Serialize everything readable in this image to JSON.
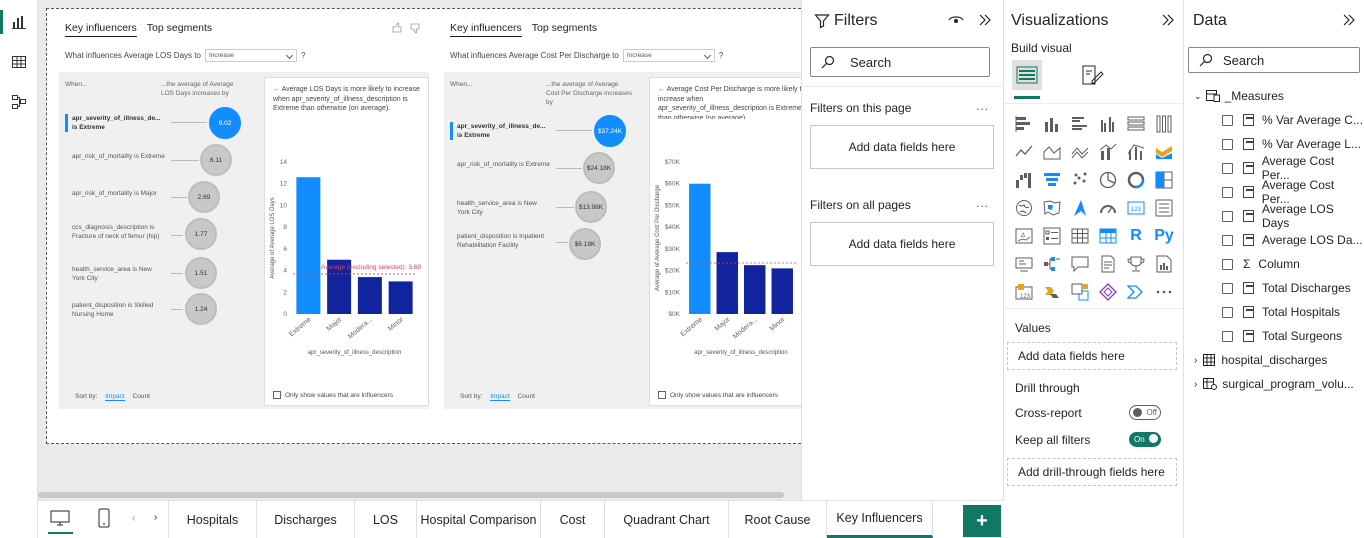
{
  "left_rail": {
    "icons": [
      "report-view-icon",
      "table-view-icon",
      "model-view-icon"
    ]
  },
  "visual1": {
    "tabs": [
      "Key influencers",
      "Top segments"
    ],
    "question": "What influences Average LOS Days to",
    "select": "Increase",
    "help": "?",
    "when": "When...",
    "then": "...the average of Average LOS Days increases by",
    "influencers": [
      {
        "label": "apr_severity_of_illness_de... is Extreme",
        "value": "9.02",
        "selected": true
      },
      {
        "label": "apr_risk_of_mortality is Extreme",
        "value": "6.11"
      },
      {
        "label": "apr_risk_of_mortality is Major",
        "value": "2.69"
      },
      {
        "label": "ccs_diagnosis_description is Fracture of neck of femur (hip)",
        "value": "1.77"
      },
      {
        "label": "health_service_area is New York City",
        "value": "1.51"
      },
      {
        "label": "patient_disposition is Skilled Nursing Home",
        "value": "1.24"
      }
    ],
    "sort_by": "Sort by:",
    "sort_impact": "Impact",
    "sort_count": "Count",
    "detail_text": "Average LOS Days is more likely to increase when apr_severity_of_illness_description is Extreme than otherwise (on average).",
    "only_show": "Only show values that are influencers",
    "chart_data": {
      "type": "bar",
      "categories": [
        "Extreme",
        "Major",
        "Modera...",
        "Minor"
      ],
      "values": [
        12.6,
        5.0,
        3.4,
        3.0
      ],
      "highlight_index": 0,
      "ylabel": "Average of Average LOS Days",
      "xlabel": "apr_severity_of_illness_description",
      "ylim": [
        0,
        14
      ],
      "yticks": [
        "0",
        "2",
        "4",
        "6",
        "8",
        "10",
        "12",
        "14"
      ],
      "ytick_values": [
        0,
        2,
        4,
        6,
        8,
        10,
        12,
        14
      ],
      "reference_value": 3.69,
      "reference_label": "Average (excluding selected): 3.69"
    }
  },
  "visual2": {
    "tabs": [
      "Key influencers",
      "Top segments"
    ],
    "question": "What influences Average Cost Per Discharge to",
    "select": "Increase",
    "help": "?",
    "when": "When...",
    "then": "...the average of Average Cost Per Discharge increases by",
    "influencers": [
      {
        "label": "apr_severity_of_illness_de... is Extreme",
        "value": "$37.24K",
        "selected": true
      },
      {
        "label": "apr_risk_of_mortality is Extreme",
        "value": "$24.18K"
      },
      {
        "label": "health_service_area is New York City",
        "value": "$13.98K"
      },
      {
        "label": "patient_disposition is Inpatient Rehabilitation Facility",
        "value": "$6.19K"
      }
    ],
    "sort_by": "Sort by:",
    "sort_impact": "Impact",
    "sort_count": "Count",
    "detail_text": "Average Cost Per Discharge is more likely to increase when apr_severity_of_illness_description is Extreme than otherwise (on average).",
    "only_show": "Only show values that are influencers",
    "chart_data": {
      "type": "bar",
      "categories": [
        "Extreme",
        "Major",
        "Modera...",
        "Minor"
      ],
      "values": [
        60000,
        28500,
        22500,
        21000
      ],
      "highlight_index": 0,
      "ylabel": "Average of Average Cost Per Discharge",
      "xlabel": "apr_severity_of_illness_description",
      "ylim": [
        0,
        70000
      ],
      "yticks": [
        "$0K",
        "$10K",
        "$20K",
        "$30K",
        "$40K",
        "$50K",
        "$60K",
        "$70K"
      ],
      "ytick_values": [
        0,
        10000,
        20000,
        30000,
        40000,
        50000,
        60000,
        70000
      ],
      "reference_value": 23500
    }
  },
  "filters": {
    "title": "Filters",
    "search": "Search",
    "on_this_page": "Filters on this page",
    "on_all_pages": "Filters on all pages",
    "add_fields": "Add data fields here",
    "more": "..."
  },
  "visualizations": {
    "title": "Visualizations",
    "build_visual": "Build visual",
    "icons": [
      "stacked-bar-icon",
      "stacked-column-icon",
      "clustered-bar-icon",
      "clustered-column-icon",
      "100-bar-icon",
      "100-column-icon",
      "line-chart-icon",
      "area-chart-icon",
      "stacked-area-icon",
      "line-column-icon",
      "line-clustered-column-icon",
      "ribbon-chart-icon",
      "waterfall-icon",
      "funnel-icon",
      "scatter-icon",
      "pie-icon",
      "donut-icon",
      "treemap-icon",
      "map-icon",
      "filled-map-icon",
      "azure-map-icon",
      "gauge-icon",
      "card-icon",
      "multi-row-card-icon",
      "kpi-icon",
      "slicer-icon",
      "table-icon",
      "matrix-icon",
      "r-visual-icon",
      "python-visual-icon",
      "key-influencers-icon",
      "decomposition-tree-icon",
      "qa-icon",
      "smart-narrative-icon",
      "metrics-icon",
      "paginated-report-icon",
      "power-apps-icon",
      "power-automate-icon",
      "custom-visual-icon",
      "diamond-icon",
      "chevrons-icon",
      "more-icon"
    ],
    "r_label": "R",
    "py_label": "Py",
    "values": "Values",
    "add_fields": "Add data fields here",
    "drill_through": "Drill through",
    "cross_report": "Cross-report",
    "cross_report_state": "Off",
    "keep_filters": "Keep all filters",
    "keep_filters_state": "On",
    "add_drill": "Add drill-through fields here"
  },
  "data_pane": {
    "title": "Data",
    "search": "Search",
    "measures_table": "_Measures",
    "measures": [
      "% Var Average C...",
      "% Var Average L...",
      "Average Cost Per...",
      "Average Cost Per...",
      "Average LOS Days",
      "Average LOS Da...",
      "Column",
      "Total Discharges",
      "Total Hospitals",
      "Total Surgeons"
    ],
    "tables": [
      "hospital_discharges",
      "surgical_program_volu..."
    ]
  },
  "pages": [
    "Hospitals",
    "Discharges",
    "LOS",
    "Hospital Comparison",
    "Cost",
    "Quadrant Chart",
    "Root Cause",
    "Key Influencers"
  ],
  "active_page": "Key Influencers",
  "colors": {
    "accent": "#117865",
    "highlight": "#118dff",
    "bar": "#12239e"
  }
}
